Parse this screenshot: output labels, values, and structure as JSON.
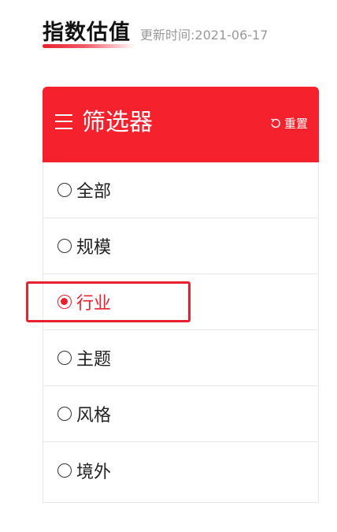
{
  "header": {
    "title": "指数估值",
    "update_time": "更新时间:2021-06-17"
  },
  "filter": {
    "title": "筛选器",
    "menu_icon": "menu-icon",
    "reset_icon": "refresh-icon",
    "reset_label": "重置",
    "accent_color": "#f5222d",
    "options": [
      {
        "label": "全部",
        "selected": false
      },
      {
        "label": "规模",
        "selected": false
      },
      {
        "label": "行业",
        "selected": true
      },
      {
        "label": "主题",
        "selected": false
      },
      {
        "label": "风格",
        "selected": false
      },
      {
        "label": "境外",
        "selected": false
      }
    ]
  }
}
